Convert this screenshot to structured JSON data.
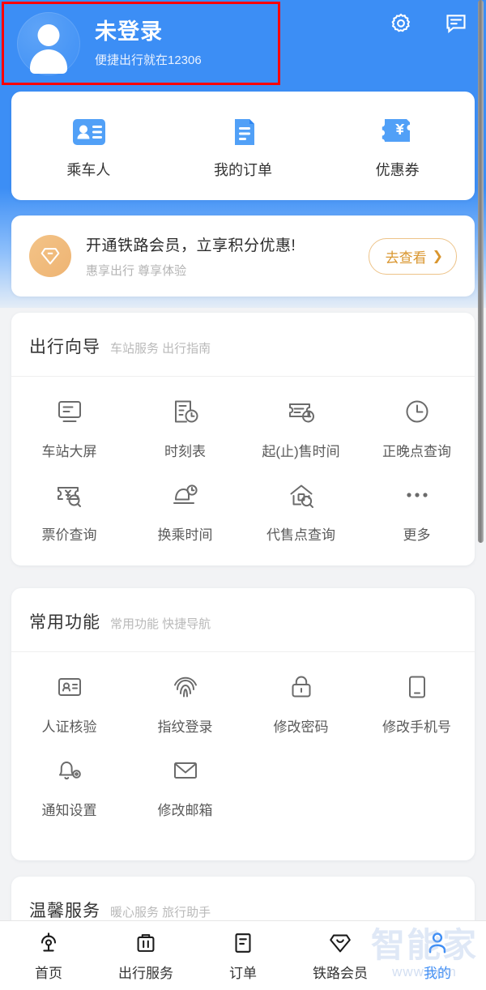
{
  "colors": {
    "brand_blue": "#3c8ef5",
    "accent_gold": "#d9962f",
    "highlight_red": "#ff0000",
    "text_dark": "#333333",
    "text_muted": "#b9b9b9"
  },
  "header": {
    "title": "未登录",
    "subtitle": "便捷出行就在12306",
    "avatar_name": "default-avatar",
    "icons": [
      {
        "name": "settings-gear-icon"
      },
      {
        "name": "message-chat-icon"
      }
    ]
  },
  "quick_actions": [
    {
      "label": "乘车人",
      "icon": "passenger-card-icon"
    },
    {
      "label": "我的订单",
      "icon": "order-document-icon"
    },
    {
      "label": "优惠券",
      "icon": "coupon-yuan-icon"
    }
  ],
  "member_banner": {
    "title": "开通铁路会员，立享积分优惠!",
    "subtitle": "惠享出行 尊享体验",
    "button_label": "去查看",
    "icon": "diamond-gem-icon"
  },
  "sections": [
    {
      "title": "出行向导",
      "subtitle": "车站服务 出行指南",
      "items": [
        {
          "label": "车站大屏",
          "icon": "station-screen-icon"
        },
        {
          "label": "时刻表",
          "icon": "timetable-clock-icon"
        },
        {
          "label": "起(止)售时间",
          "icon": "ticket-clock-icon"
        },
        {
          "label": "正晚点查询",
          "icon": "clock-icon"
        },
        {
          "label": "票价查询",
          "icon": "fare-search-icon"
        },
        {
          "label": "换乘时间",
          "icon": "transfer-time-icon"
        },
        {
          "label": "代售点查询",
          "icon": "agency-search-icon"
        },
        {
          "label": "更多",
          "icon": "more-dots-icon"
        }
      ]
    },
    {
      "title": "常用功能",
      "subtitle": "常用功能 快捷导航",
      "items": [
        {
          "label": "人证核验",
          "icon": "id-verify-icon"
        },
        {
          "label": "指纹登录",
          "icon": "fingerprint-icon"
        },
        {
          "label": "修改密码",
          "icon": "lock-icon"
        },
        {
          "label": "修改手机号",
          "icon": "phone-icon"
        },
        {
          "label": "通知设置",
          "icon": "bell-settings-icon"
        },
        {
          "label": "修改邮箱",
          "icon": "envelope-icon"
        }
      ]
    },
    {
      "title": "温馨服务",
      "subtitle": "暖心服务 旅行助手",
      "items": []
    }
  ],
  "bottom_nav": {
    "items": [
      {
        "label": "首页",
        "icon": "railway-home-icon",
        "active": false
      },
      {
        "label": "出行服务",
        "icon": "suitcase-icon",
        "active": false
      },
      {
        "label": "订单",
        "icon": "order-list-icon",
        "active": false
      },
      {
        "label": "铁路会员",
        "icon": "diamond-member-icon",
        "active": false
      },
      {
        "label": "我的",
        "icon": "person-icon",
        "active": true
      }
    ]
  },
  "watermark": {
    "text": "智能家",
    "url": "www.com"
  }
}
